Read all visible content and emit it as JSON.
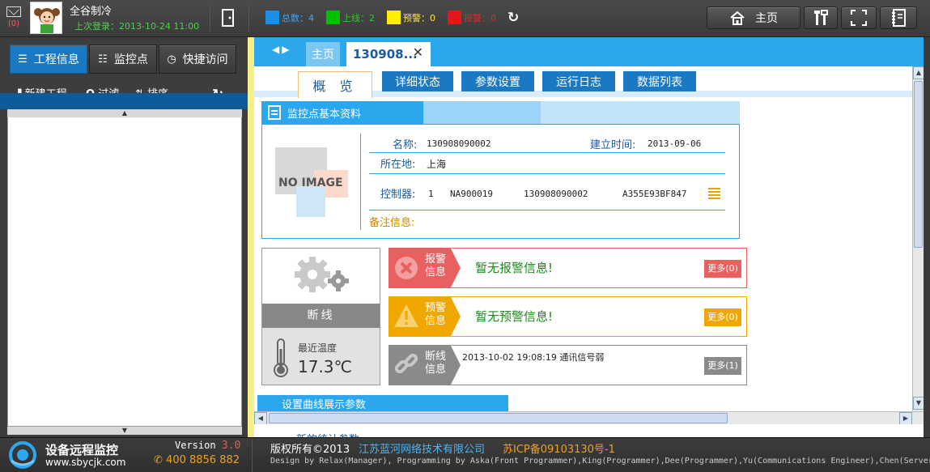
{
  "header": {
    "mail_count": "(0)",
    "username": "全谷制冷",
    "last_login": "上次登录：2013-10-24 11:00",
    "stats": [
      {
        "label": "总数：4",
        "color": "#1b8fe6",
        "text_color": "#3aa8ff"
      },
      {
        "label": "上线：2",
        "color": "#00c000",
        "text_color": "#1fd41f"
      },
      {
        "label": "预警：0",
        "color": "#ffee00",
        "text_color": "#ffe640"
      },
      {
        "label": "报警：0",
        "color": "#e01818",
        "text_color": "#d03030"
      }
    ],
    "home_label": "主页"
  },
  "sidebar": {
    "tabs": [
      {
        "label": "工程信息",
        "icon": "list-icon"
      },
      {
        "label": "监控点",
        "icon": "list-icon"
      },
      {
        "label": "快捷访问",
        "icon": "clock-icon"
      }
    ],
    "toolbar": {
      "new_project": "新建工程",
      "filter": "过滤",
      "sort": "排序"
    }
  },
  "tabs": {
    "home": "主页",
    "current": "130908..."
  },
  "subtabs": [
    "概 览",
    "详细状态",
    "参数设置",
    "运行日志",
    "数据列表"
  ],
  "info": {
    "section_title": "监控点基本资料",
    "no_image": "NO IMAGE",
    "name_label": "名称:",
    "name_value": "130908090002",
    "created_label": "建立时间:",
    "created_value": "2013-09-06",
    "location_label": "所在地:",
    "location_value": "上海",
    "controller_label": "控制器:",
    "controller_values": [
      "1",
      "NA900019",
      "130908090002",
      "A355E93BF847"
    ],
    "remark_label": "备注信息:"
  },
  "device": {
    "status": "断线",
    "temp_label": "最近温度",
    "temp_value": "17.3℃"
  },
  "alerts": [
    {
      "badge": "报警信息",
      "message": "暂无报警信息!",
      "more": "更多(0)",
      "color": "#e86060",
      "border": "#e86060"
    },
    {
      "badge": "预警信息",
      "message": "暂无预警信息!",
      "more": "更多(0)",
      "color": "#f0a800",
      "border": "#f0a800"
    },
    {
      "badge": "断线信息",
      "message": "2013-10-02 19:08:19  通讯信号弱",
      "more": "更多(1)",
      "color": "#8a8a8a",
      "border": "#8a8a8a"
    }
  ],
  "bottom": {
    "section_title": "设置曲线展示参数",
    "next_title": "新的统计参数"
  },
  "footer": {
    "brand": "设备远程监控",
    "site": "www.sbycjk.com",
    "version_label": "Version",
    "version_num": "3.0",
    "phone": "400 8856 882",
    "copyright": "版权所有©2013",
    "company": "江苏蓝河网络技术有限公司",
    "icp": "苏ICP备09103130号-1",
    "credits": "Design by Relax(Manager), Programming by Aska(Front Programmer),King(Programmer),Dee(Programmer),Yu(Communications Engineer),Chen(Server"
  }
}
